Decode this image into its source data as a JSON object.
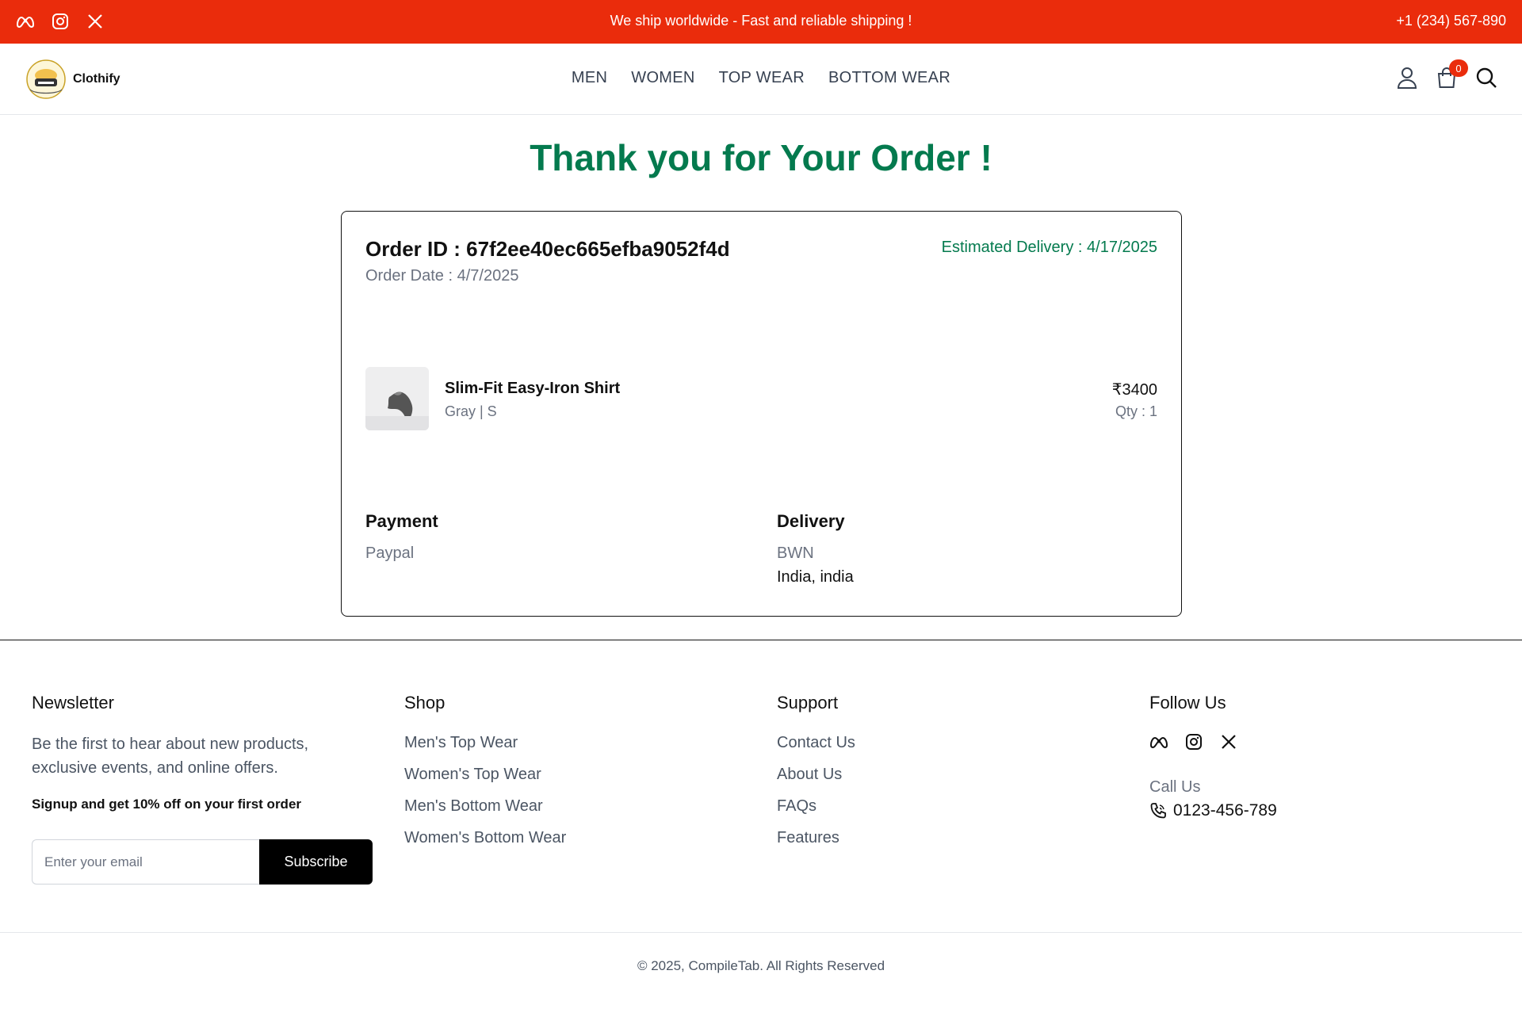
{
  "topbar": {
    "socials": [
      "meta-icon",
      "instagram-icon",
      "x-icon"
    ],
    "announcement": "We ship worldwide - Fast and reliable shipping !",
    "phone": "+1 (234) 567-890",
    "bg_color": "#ea2c0c"
  },
  "header": {
    "logo_text": "Clothify",
    "nav": [
      "MEN",
      "WOMEN",
      "TOP WEAR",
      "BOTTOM WEAR"
    ],
    "cart_count": "0",
    "icons": [
      "user-icon",
      "cart-icon",
      "search-icon"
    ]
  },
  "main": {
    "heading": "Thank you for Your Order !",
    "heading_color": "#047a4e",
    "order": {
      "id_line": "Order ID : 67f2ee40ec665efba9052f4d",
      "date_line": "Order Date : 4/7/2025",
      "estimated_delivery": "Estimated Delivery : 4/17/2025"
    },
    "item": {
      "name": "Slim-Fit Easy-Iron Shirt",
      "variant": "Gray | S",
      "price": "₹3400",
      "qty": "Qty : 1"
    },
    "payment": {
      "title": "Payment",
      "method": "Paypal"
    },
    "delivery": {
      "title": "Delivery",
      "address_line1": "BWN",
      "address_line2": "India, india"
    }
  },
  "footer": {
    "newsletter": {
      "title": "Newsletter",
      "text": "Be the first to hear about new products, exclusive events, and online offers.",
      "signup": "Signup and get 10% off on your first order",
      "placeholder": "Enter your email",
      "button": "Subscribe"
    },
    "shop": {
      "title": "Shop",
      "links": [
        "Men's Top Wear",
        "Women's Top Wear",
        "Men's Bottom Wear",
        "Women's Bottom Wear"
      ]
    },
    "support": {
      "title": "Support",
      "links": [
        "Contact Us",
        "About Us",
        "FAQs",
        "Features"
      ]
    },
    "follow": {
      "title": "Follow Us",
      "socials": [
        "meta-icon",
        "instagram-icon",
        "x-icon"
      ],
      "call_label": "Call Us",
      "phone": "0123-456-789"
    },
    "copyright": "© 2025, CompileTab. All Rights Reserved"
  }
}
